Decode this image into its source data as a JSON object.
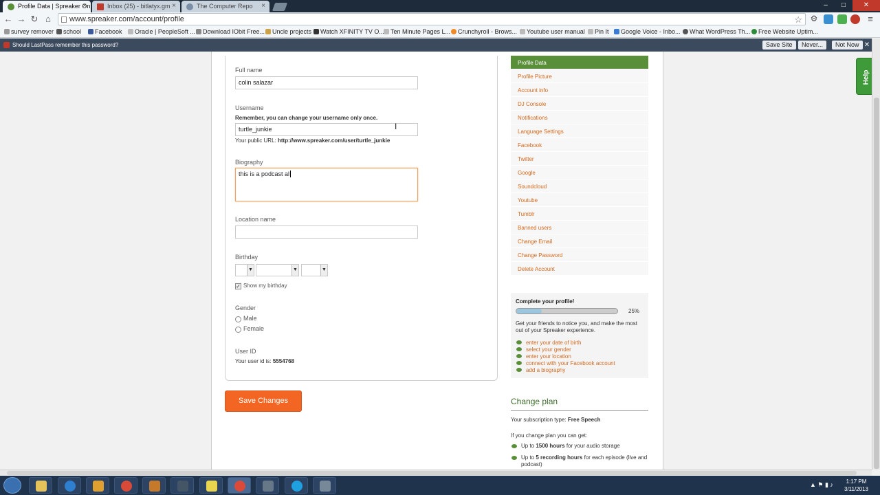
{
  "browser": {
    "tabs": [
      {
        "title": "Profile Data | Spreaker Onl",
        "active": true,
        "close": "×"
      },
      {
        "title": "Inbox (25) - bitlatyx.gm",
        "active": false,
        "close": "×"
      },
      {
        "title": "The Computer Repo",
        "active": false,
        "close": "×"
      }
    ],
    "url": "www.spreaker.com/account/profile",
    "bookmarks": [
      "survey remover",
      "school",
      "Facebook",
      "Oracle | PeopleSoft ...",
      "Download IObit Free...",
      "Uncle projects",
      "Watch XFINITY TV O...",
      "Ten Minute Pages L...",
      "Crunchyroll - Brows...",
      "Youtube user manual",
      "Pin It",
      "Google Voice - Inbo...",
      "What WordPress Th...",
      "Free Website Uptim..."
    ],
    "lastpass": {
      "message": "Should LastPass remember this password?",
      "save": "Save Site",
      "never": "Never...",
      "not_now": "Not Now",
      "close": "✕"
    }
  },
  "form": {
    "full_name_label": "Full name",
    "full_name_value": "colin salazar",
    "username_label": "Username",
    "username_note": "Remember, you can change your username only once.",
    "username_value": "turtle_junkie",
    "public_url_prefix": "Your public URL:",
    "public_url": "http://www.spreaker.com/user/turtle_junkie",
    "biography_label": "Biography",
    "biography_value": "this is a podcast al",
    "location_label": "Location name",
    "location_value": "",
    "birthday_label": "Birthday",
    "show_birthday_label": "Show my birthday",
    "show_birthday_checked": true,
    "gender_label": "Gender",
    "gender_male": "Male",
    "gender_female": "Female",
    "user_id_label": "User ID",
    "user_id_prefix": "Your user id is:",
    "user_id_value": "5554768",
    "save_button": "Save Changes"
  },
  "sidebar": {
    "items": [
      "Profile Data",
      "Profile Picture",
      "Account info",
      "DJ Console",
      "Notifications",
      "Language Settings",
      "Facebook",
      "Twitter",
      "Google",
      "Soundcloud",
      "Youtube",
      "Tumblr",
      "Banned users",
      "Change Email",
      "Change Password",
      "Delete Account"
    ],
    "active_index": 0
  },
  "profile_completion": {
    "title": "Complete your profile!",
    "percent": 25,
    "percent_label": "25%",
    "description": "Get your friends to notice you, and make the most out of your Spreaker experience.",
    "tasks": [
      "enter your date of birth",
      "select your gender",
      "enter your location",
      "connect with your Facebook account",
      "add a biography"
    ]
  },
  "plan": {
    "heading": "Change plan",
    "subscription_prefix": "Your subscription type:",
    "subscription_type": "Free Speech",
    "if_change": "If you change plan you can get:",
    "benefit1_pre": "Up to ",
    "benefit1_bold": "1500 hours",
    "benefit1_post": " for your audio storage",
    "benefit2_pre": "Up to ",
    "benefit2_bold": "5 recording hours",
    "benefit2_post": " for each episode (live and podcast)"
  },
  "help_tab": "Help",
  "taskbar": {
    "time": "1:17 PM",
    "date": "3/11/2013"
  },
  "colors": {
    "accent_orange": "#f26522",
    "accent_green": "#5a8f3a",
    "link_orange": "#d2691e"
  }
}
